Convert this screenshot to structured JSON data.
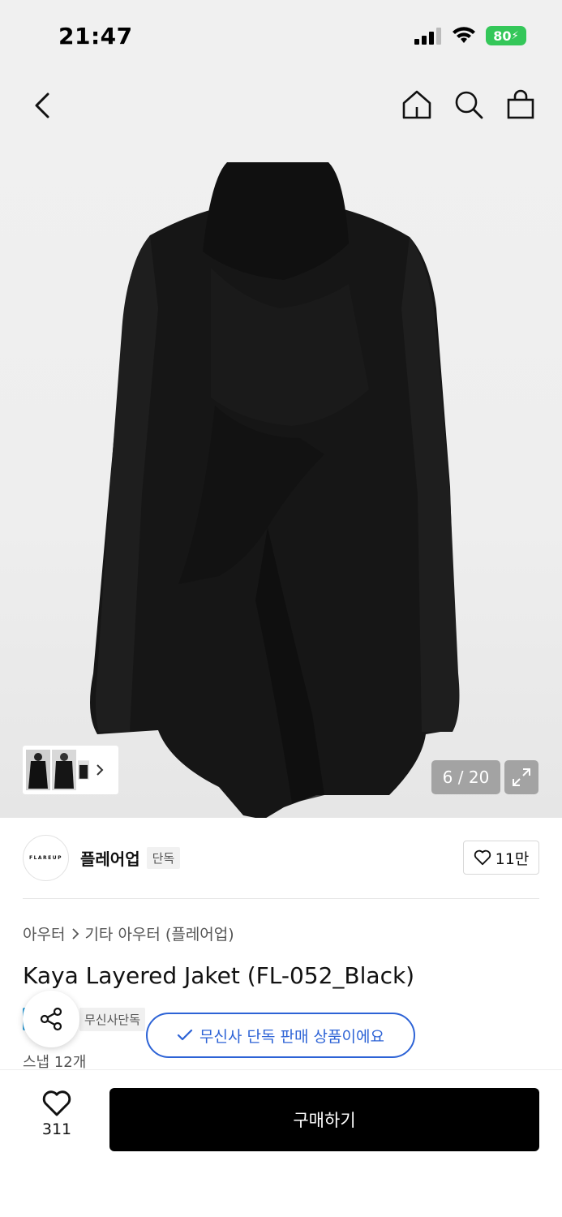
{
  "status_bar": {
    "time": "21:47",
    "battery": "80"
  },
  "nav": {
    "back_icon": "chevron-left-icon",
    "home_icon": "home-icon",
    "search_icon": "search-icon",
    "cart_icon": "shopping-bag-icon"
  },
  "gallery": {
    "current_page": "6 / 20",
    "expand_icon": "expand-icon"
  },
  "brand": {
    "logo_text": "FLAREUP",
    "name": "플레어업",
    "badge": "단독",
    "likes": "11만"
  },
  "breadcrumb": {
    "category": "아우터",
    "subcategory": "기타 아우터 (플레어업)"
  },
  "product": {
    "title": "Kaya Layered Jaket (FL-052_Black)",
    "tag": "무신사단독",
    "snap_count": "스냅 12개"
  },
  "toast": {
    "message": "무신사 단독 판매 상품이에요"
  },
  "bottom_bar": {
    "wish_count": "311",
    "buy_label": "구매하기"
  },
  "colors": {
    "accent_blue": "#2d63d6",
    "battery_green": "#34c759",
    "buy_button": "#000000"
  }
}
